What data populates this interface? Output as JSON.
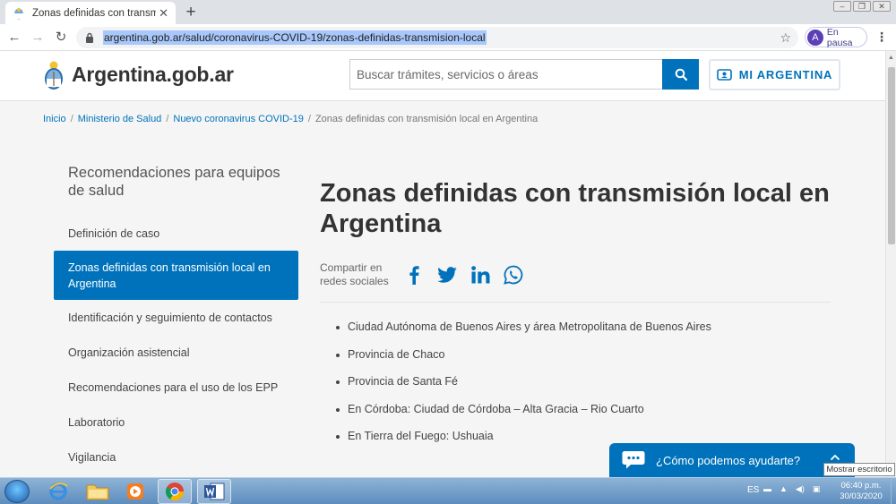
{
  "browser": {
    "tab_title": "Zonas definidas con transmisión local en A",
    "tab_close": "✕",
    "new_tab": "+",
    "url": "argentina.gob.ar/salud/coronavirus-COVID-19/zonas-definidas-transmision-local",
    "profile_initial": "A",
    "profile_label": "En pausa"
  },
  "header": {
    "logo_text": "Argentina.gob.ar",
    "search_placeholder": "Buscar trámites, servicios o áreas",
    "mi_argentina_label": "MI ARGENTINA"
  },
  "breadcrumb": {
    "items": [
      "Inicio",
      "Ministerio de Salud",
      "Nuevo coronavirus COVID-19"
    ],
    "current": "Zonas definidas con transmisión local en Argentina"
  },
  "sidebar": {
    "title": "Recomendaciones para equipos de salud",
    "items": [
      {
        "label": "Definición de caso"
      },
      {
        "label": "Zonas definidas con transmisión local en Argentina",
        "active": true
      },
      {
        "label": "Identificación y seguimiento de contactos"
      },
      {
        "label": "Organización asistencial"
      },
      {
        "label": "Recomendaciones para el uso de los EPP"
      },
      {
        "label": "Laboratorio"
      },
      {
        "label": "Vigilancia"
      }
    ]
  },
  "main": {
    "title": "Zonas definidas con transmisión local en Argentina",
    "share_label": "Compartir en redes sociales",
    "zones": [
      "Ciudad Autónoma de Buenos Aires y área Metropolitana de Buenos Aires",
      "Provincia de Chaco",
      "Provincia de Santa Fé",
      "En Córdoba: Ciudad de Córdoba – Alta Gracia – Rio Cuarto",
      "En Tierra del Fuego: Ushuaia"
    ]
  },
  "chat": {
    "label": "¿Cómo podemos ayudarte?"
  },
  "tooltip": "Mostrar escritorio",
  "taskbar": {
    "language": "ES",
    "time": "06:40 p.m.",
    "date": "30/03/2020"
  },
  "colors": {
    "brand_blue": "#0072bb",
    "content_bg": "#f5f5f5"
  }
}
